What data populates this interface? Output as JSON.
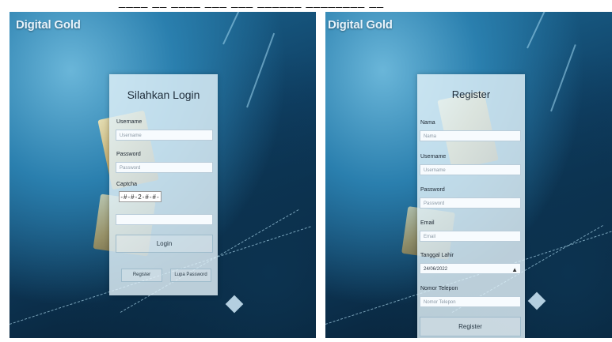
{
  "login": {
    "brand": "Digital Gold",
    "title": "Silahkan Login",
    "username_label": "Username",
    "username_placeholder": "Username",
    "password_label": "Password",
    "password_placeholder": "Password",
    "captcha_label": "Captcha",
    "captcha_text": "-#-#-2-#-#-",
    "login_button": "Login",
    "register_button": "Register",
    "forgot_button": "Lupa Password"
  },
  "register": {
    "brand": "Digital Gold",
    "title": "Register",
    "name_label": "Nama",
    "name_placeholder": "Nama",
    "username_label": "Username",
    "username_placeholder": "Username",
    "password_label": "Password",
    "password_placeholder": "Password",
    "email_label": "Email",
    "email_placeholder": "Email",
    "birthdate_label": "Tanggal Lahir",
    "birthdate_value": "24/06/2022",
    "phone_label": "Nomor Telepon",
    "phone_placeholder": "Nomor Telepon",
    "register_button": "Register",
    "calendar_icon": "calendar-icon"
  }
}
